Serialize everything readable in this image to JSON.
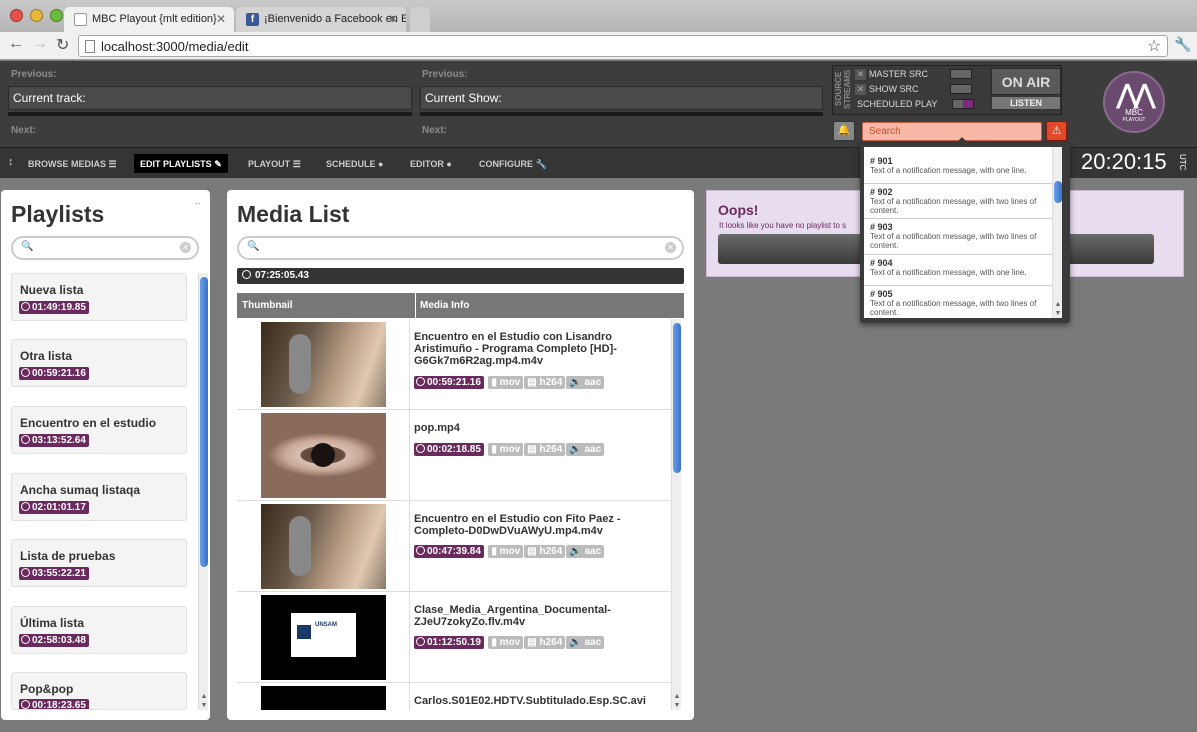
{
  "browser": {
    "tabs": [
      {
        "title": "MBC Playout {mlt edition}",
        "favicon": "page-icon"
      },
      {
        "title": "¡Bienvenido a Facebook en E",
        "favicon": "facebook-icon"
      }
    ],
    "url": "localhost:3000/media/edit"
  },
  "header": {
    "previous_label": "Previous:",
    "current_track_label": "Current track:",
    "next_label": "Next:",
    "previous_show_label": "Previous:",
    "current_show_label": "Current Show:",
    "next_show_label": "Next:",
    "source_streams_label": "SOURCE STREAMS",
    "sources": [
      "MASTER SRC",
      "SHOW SRC",
      "SCHEDULED PLAY"
    ],
    "on_air": "ON AIR",
    "listen": "LISTEN",
    "search_placeholder": "Search",
    "logo_title": "MBC",
    "logo_sub": "PLAYOUT"
  },
  "nav": {
    "items": [
      "BROWSE MEDIAS",
      "EDIT PLAYLISTS",
      "PLAYOUT",
      "SCHEDULE",
      "EDITOR",
      "CONFIGURE"
    ],
    "active": "EDIT PLAYLISTS",
    "clock": "20:20:15",
    "tz": "UTC"
  },
  "playlists": {
    "title": "Playlists",
    "items": [
      {
        "name": "Nueva lista",
        "duration": "01:49:19.85"
      },
      {
        "name": "Otra lista",
        "duration": "00:59:21.16"
      },
      {
        "name": "Encuentro en el estudio",
        "duration": "03:13:52.64"
      },
      {
        "name": "Ancha sumaq listaqa",
        "duration": "02:01:01.17"
      },
      {
        "name": "Lista de pruebas",
        "duration": "03:55:22.21"
      },
      {
        "name": "Última lista",
        "duration": "02:58:03.48"
      },
      {
        "name": "Pop&pop",
        "duration": "00:18:23.65"
      }
    ]
  },
  "media_list": {
    "title": "Media List",
    "total": "07:25:05.43",
    "columns": [
      "Thumbnail",
      "Media Info"
    ],
    "rows": [
      {
        "title": "Encuentro en el Estudio con Lisandro Aristimuño - Programa Completo [HD]-G6Gk7m6R2ag.mp4.m4v",
        "duration": "00:59:21.16",
        "format": "mov",
        "video": "h264",
        "audio": "aac"
      },
      {
        "title": "pop.mp4",
        "duration": "00:02:18.85",
        "format": "mov",
        "video": "h264",
        "audio": "aac"
      },
      {
        "title": "Encuentro en el Estudio con Fito Paez - Completo-D0DwDVuAWyU.mp4.m4v",
        "duration": "00:47:39.84",
        "format": "mov",
        "video": "h264",
        "audio": "aac"
      },
      {
        "title": "Clase_Media_Argentina_Documental-ZJeU7zokyZo.flv.m4v",
        "duration": "01:12:50.19",
        "format": "mov",
        "video": "h264",
        "audio": "aac"
      },
      {
        "title": "Carlos.S01E02.HDTV.Subtitulado.Esp.SC.avi",
        "duration": "",
        "format": "",
        "video": "",
        "audio": ""
      }
    ],
    "unsam_label": "UNSAM"
  },
  "oops": {
    "title": "Oops!",
    "text": "It looks like you have no playlist to s"
  },
  "notifications": [
    {
      "id": "# 901",
      "text": "Text of a notification message, with one line."
    },
    {
      "id": "# 902",
      "text": "Text of a notification message, with two lines of content."
    },
    {
      "id": "# 903",
      "text": "Text of a notification message, with two lines of content."
    },
    {
      "id": "# 904",
      "text": "Text of a notification message, with one line."
    },
    {
      "id": "# 905",
      "text": "Text of a notification message, with two lines of content."
    }
  ]
}
